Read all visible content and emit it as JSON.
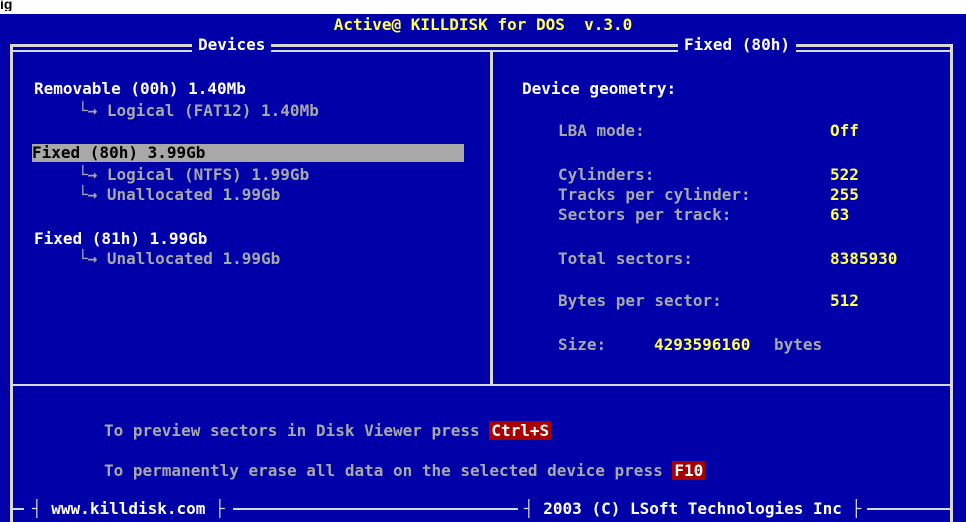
{
  "window": {
    "title": "Active@ KILLDISK for DOS  v.3.0",
    "devices_panel_title": "Devices",
    "details_panel_title": "Fixed (80h)"
  },
  "devices": [
    {
      "label": "Removable (00h) 1.40Mb",
      "children": [
        "Logical (FAT12) 1.40Mb"
      ]
    },
    {
      "label": "Fixed (80h) 3.99Gb",
      "selected": true,
      "children": [
        "Logical (NTFS) 1.99Gb",
        "Unallocated 1.99Gb"
      ]
    },
    {
      "label": "Fixed (81h) 1.99Gb",
      "children": [
        "Unallocated 1.99Gb"
      ]
    }
  ],
  "tree_arrow": "└→",
  "geometry": {
    "heading": "Device geometry:",
    "lba_label": "LBA mode:",
    "lba_value": "Off",
    "cyl_label": "Cylinders:",
    "cyl_value": "522",
    "tpc_label": "Tracks per cylinder:",
    "tpc_value": "255",
    "spt_label": "Sectors per track:",
    "spt_value": "63",
    "total_label": "Total sectors:",
    "total_value": "8385930",
    "bps_label": "Bytes per sector:",
    "bps_value": "512",
    "size_label": "Size:",
    "size_value": "4293596160",
    "size_unit": "bytes"
  },
  "hints": {
    "preview_text": "To preview sectors in Disk Viewer press ",
    "preview_key": "Ctrl+S",
    "erase_text": "To permanently erase all data on the selected device press ",
    "erase_key": "F10"
  },
  "footer": {
    "website": "www.killdisk.com",
    "copyright": "2003 (C) LSoft Technologies Inc"
  },
  "colors": {
    "background": "#0000a8",
    "text": "#a8a8a8",
    "title": "#ffff55",
    "value": "#ffff55",
    "selection": "#a8a8a8",
    "key_highlight": "#a80000"
  }
}
